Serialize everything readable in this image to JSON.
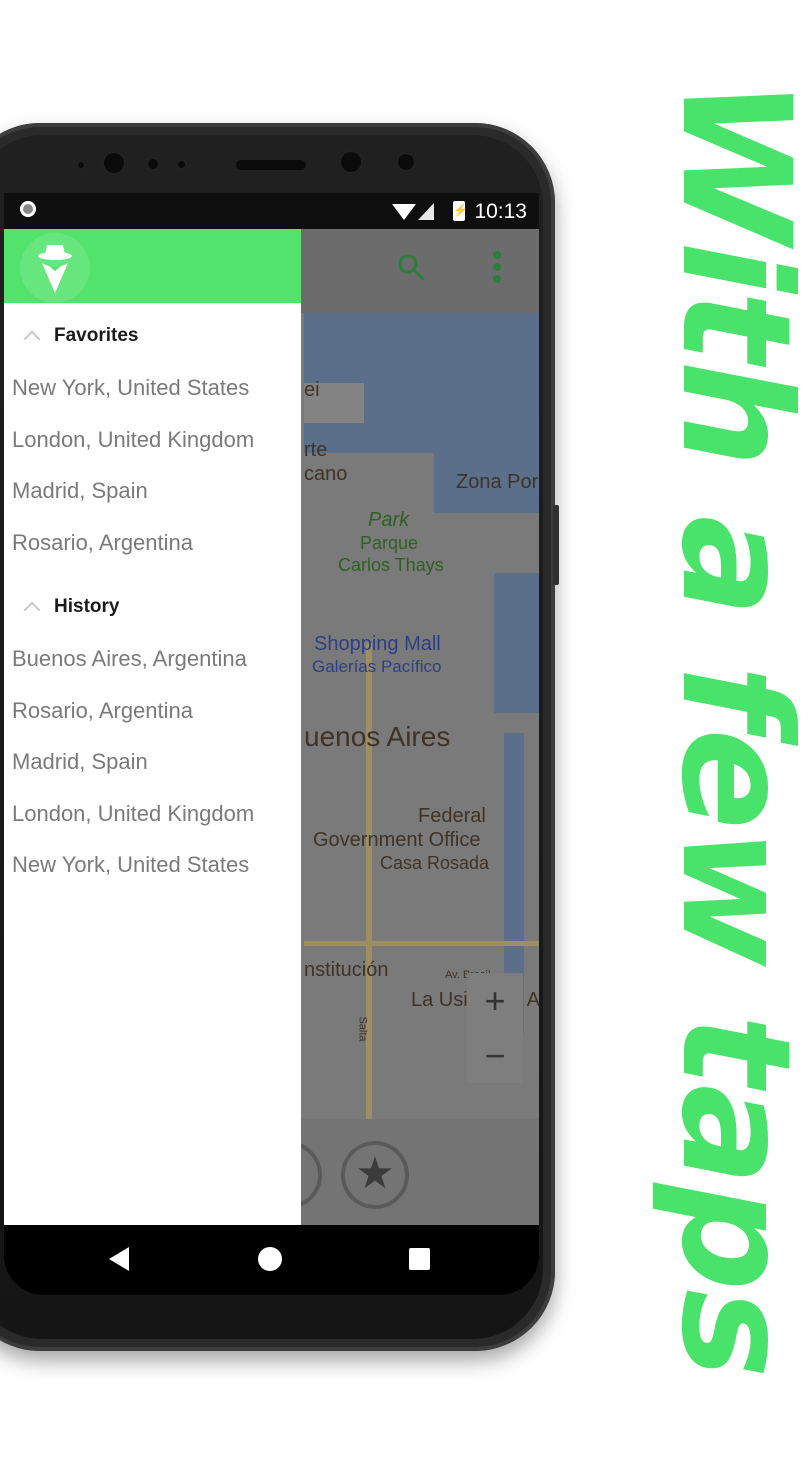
{
  "promo": {
    "headline": "With a few taps",
    "color": "#49e26a"
  },
  "status_bar": {
    "time": "10:13"
  },
  "app": {
    "accent_color": "#51e36b",
    "toolbar": {
      "search_icon": "search-icon",
      "menu_icon": "more-vert-icon"
    },
    "drawer": {
      "logo_icon": "incognito-hat-icon",
      "sections": [
        {
          "title": "Favorites",
          "items": [
            "New York, United States",
            "London, United Kingdom",
            "Madrid, Spain",
            "Rosario, Argentina"
          ]
        },
        {
          "title": "History",
          "items": [
            "Buenos Aires, Argentina",
            "Rosario, Argentina",
            "Madrid, Spain",
            "London, United Kingdom",
            "New York, United States"
          ]
        }
      ]
    },
    "map": {
      "labels": {
        "ei": "ei",
        "rte": "rte",
        "cano": "cano",
        "zona": "Zona Por",
        "park": "Park",
        "parque": "Parque",
        "carlos": "Carlos Thays",
        "shopping": "Shopping Mall",
        "galerias": "Galerías Pacífico",
        "city": "uenos Aires",
        "federal": "Federal",
        "gov": "Government Office",
        "casa": "Casa Rosada",
        "constitucion": "nstitución",
        "brasil": "Av. Brasil",
        "usina": "La Usina del A",
        "salta": "Salta"
      },
      "zoom_in": "+",
      "zoom_out": "−"
    },
    "bottom_panel": {
      "favorite_icon": "star-icon"
    }
  },
  "nav_bar": {
    "back": "back-icon",
    "home": "home-icon",
    "recents": "recents-icon"
  }
}
